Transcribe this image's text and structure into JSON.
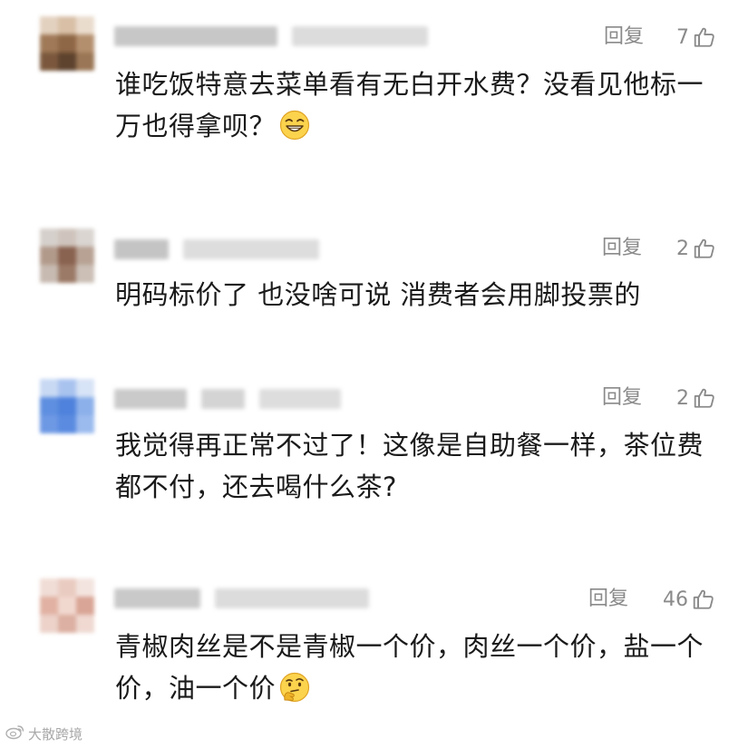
{
  "comments": [
    {
      "reply_label": "回复",
      "like_count": "7",
      "text": "谁吃饭特意去菜单看有无白开水费？没看见他标一万也得拿呗？",
      "emoji": "grinning-face-emoji"
    },
    {
      "reply_label": "回复",
      "like_count": "2",
      "text": "明码标价了 也没啥可说 消费者会用脚投票的"
    },
    {
      "reply_label": "回复",
      "like_count": "2",
      "text": "我觉得再正常不过了！这像是自助餐一样，茶位费都不付，还去喝什么茶?"
    },
    {
      "reply_label": "回复",
      "like_count": "46",
      "text": "青椒肉丝是不是青椒一个价，肉丝一个价，盐一个价，油一个价",
      "emoji": "thinking-face-emoji"
    }
  ],
  "watermark": {
    "text": "大散跨境",
    "icon": "weibo-logo-icon"
  },
  "colors": {
    "meta_text": "#8a8a8a",
    "body_text": "#1a1a1a",
    "watermark": "#a8a8a8",
    "background": "#ffffff"
  }
}
